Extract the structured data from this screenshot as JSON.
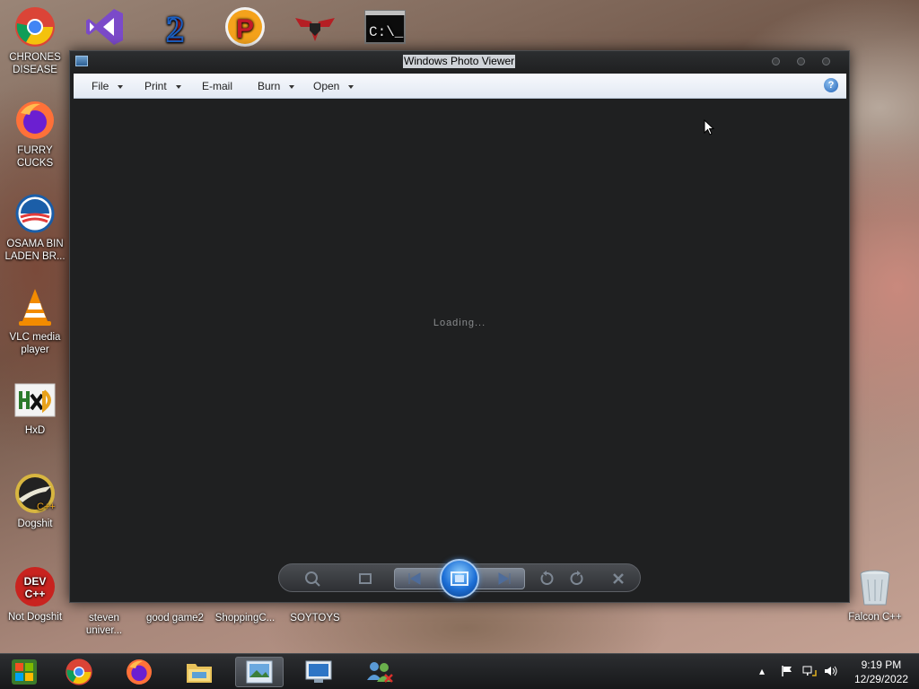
{
  "desktop": {
    "left_icons": [
      {
        "label": "CHRONES DISEASE",
        "icon": "chrome-icon"
      },
      {
        "label": "FURRY CUCKS",
        "icon": "firefox-icon"
      },
      {
        "label": "OSAMA BIN LADEN BR...",
        "icon": "obama-logo-icon"
      },
      {
        "label": "VLC media player",
        "icon": "vlc-cone-icon"
      },
      {
        "label": "HxD",
        "icon": "hxd-icon"
      },
      {
        "label": "Dogshit",
        "icon": "falcon-cpp-icon"
      },
      {
        "label": "Not Dogshit",
        "icon": "dev-cpp-icon"
      }
    ],
    "top_icons": [
      "visual-studio-icon",
      "game2-icon",
      "pinball-p-icon",
      "shield-wings-icon",
      "console-icon"
    ],
    "bottom_icons": [
      {
        "label": "steven univer...",
        "icon": "file-icon"
      },
      {
        "label": "good game2",
        "icon": "file-icon"
      },
      {
        "label": "ShoppingC...",
        "icon": "file-icon"
      },
      {
        "label": "SOYTOYS",
        "icon": "file-icon"
      }
    ],
    "recycle_bin": {
      "label": "Falcon C++",
      "icon": "recycle-bin-icon"
    }
  },
  "viewer": {
    "title": "Windows Photo Viewer",
    "menu": [
      {
        "label": "File",
        "has_dropdown": true
      },
      {
        "label": "Print",
        "has_dropdown": true
      },
      {
        "label": "E-mail",
        "has_dropdown": false
      },
      {
        "label": "Burn",
        "has_dropdown": true
      },
      {
        "label": "Open",
        "has_dropdown": true
      }
    ],
    "help_glyph": "?",
    "status": "Loading...",
    "controls": [
      "zoom-icon",
      "actual-size-icon",
      "previous-icon",
      "slideshow-icon",
      "next-icon",
      "rotate-left-icon",
      "rotate-right-icon",
      "delete-icon"
    ]
  },
  "taskbar": {
    "items": [
      "start-orb-icon",
      "chrome-icon",
      "firefox-icon",
      "explorer-icon",
      "photo-viewer-icon",
      "remote-desktop-icon",
      "network-people-icon"
    ],
    "clock": {
      "time": "9:19 PM",
      "date": "12/29/2022"
    }
  },
  "colors": {
    "window_bg": "#1f2021",
    "menubar": "#e8eef6",
    "taskbar": "#1d1e20"
  }
}
